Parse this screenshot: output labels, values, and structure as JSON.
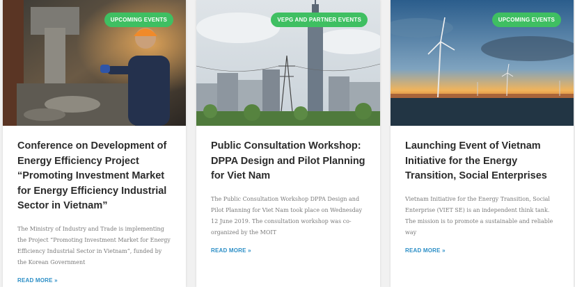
{
  "cards": [
    {
      "category": "UPCOMING EVENTS",
      "title": "Conference on Development of Energy Efficiency Project “Promoting Investment Market for Energy Efficiency Industrial Sector in Vietnam”",
      "excerpt": "The Ministry of Industry and Trade is implementing the Project “Promoting Investment Market for Energy Efficiency Industrial Sector in Vietnam”, funded by the Korean Government",
      "read_more": "READ MORE »"
    },
    {
      "category": "VEPG AND PARTNER EVENTS",
      "title": "Public Consultation Workshop: DPPA Design and Pilot Planning for Viet Nam",
      "excerpt": "The Public Consultation Workshop DPPA Design and Pilot Planning for Viet Nam took place on Wednesday 12 June 2019.  The consultation workshop was co-organized by the MOIT",
      "read_more": "READ MORE »"
    },
    {
      "category": "UPCOMING EVENTS",
      "title": "Launching Event of Vietnam Initiative for the Energy Transition, Social Enterprises",
      "excerpt": "Vietnam Initiative for the Energy Transition, Social Enterprise (VIET SE) is an independent think tank. The mission is to promote a sustainable and reliable way",
      "read_more": "READ MORE »"
    }
  ],
  "colors": {
    "badge": "#3fbf62",
    "link": "#2b8ec6",
    "title": "#2b2b2b",
    "excerpt": "#7a7a7a"
  }
}
